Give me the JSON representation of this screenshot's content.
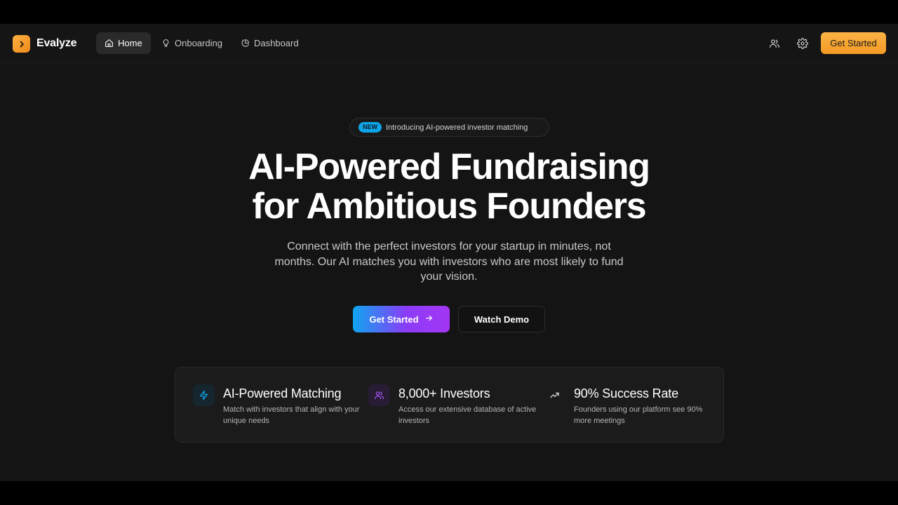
{
  "brand": {
    "name": "Evalyze",
    "accent": "#f5a025"
  },
  "nav": {
    "items": [
      {
        "label": "Home",
        "icon": "home-icon",
        "active": true
      },
      {
        "label": "Onboarding",
        "icon": "lightbulb-icon",
        "active": false
      },
      {
        "label": "Dashboard",
        "icon": "pie-chart-icon",
        "active": false
      }
    ],
    "right_icons": [
      "users-icon",
      "gear-icon"
    ],
    "cta_label": "Get Started"
  },
  "hero": {
    "badge_tag": "NEW",
    "badge_text": "Introducing AI-powered investor matching",
    "title_line1": "AI-Powered Fundraising",
    "title_line2": "for Ambitious Founders",
    "subtitle": "Connect with the perfect investors for your startup in minutes, not months. Our AI matches you with investors who are most likely to fund your vision.",
    "primary_label": "Get Started",
    "secondary_label": "Watch Demo"
  },
  "features": [
    {
      "icon": "lightning-icon",
      "title": "AI-Powered Matching",
      "desc": "Match with investors that align with your unique needs",
      "color": "#0ea5e9"
    },
    {
      "icon": "users-icon",
      "title": "8,000+ Investors",
      "desc": "Access our extensive database of active investors",
      "color": "#a855f7"
    },
    {
      "icon": "trending-up-icon",
      "title": "90% Success Rate",
      "desc": "Founders using our platform see 90% more meetings",
      "color": "#d4d4d4"
    }
  ]
}
